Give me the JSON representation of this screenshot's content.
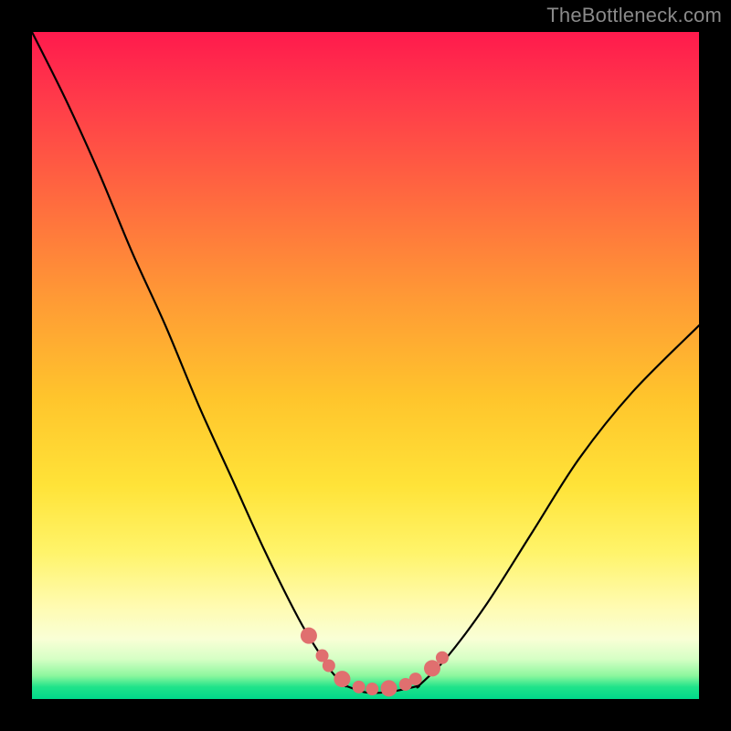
{
  "watermark": "TheBottleneck.com",
  "chart_data": {
    "type": "line",
    "title": "",
    "xlabel": "",
    "ylabel": "",
    "xlim": [
      0,
      100
    ],
    "ylim": [
      0,
      100
    ],
    "background": "red-to-green vertical gradient",
    "series": [
      {
        "name": "bottleneck-curve-left",
        "x": [
          0,
          5,
          10,
          15,
          20,
          25,
          30,
          35,
          40,
          43,
          45,
          47
        ],
        "values": [
          100,
          90,
          79,
          67,
          56,
          44,
          33,
          22,
          12,
          7,
          4,
          2
        ]
      },
      {
        "name": "bottleneck-valley",
        "x": [
          47,
          50,
          53,
          56,
          58
        ],
        "values": [
          2,
          1,
          1,
          1.5,
          2
        ]
      },
      {
        "name": "bottleneck-curve-right",
        "x": [
          58,
          62,
          68,
          75,
          82,
          90,
          100
        ],
        "values": [
          2,
          6,
          14,
          25,
          36,
          46,
          56
        ]
      }
    ],
    "marker_points": {
      "name": "highlighted-dots",
      "color": "#e06f6f",
      "x": [
        41.5,
        43.5,
        44.5,
        46.5,
        49,
        51,
        53.5,
        56,
        57.5,
        60,
        61.5
      ],
      "values": [
        9.5,
        6.5,
        5,
        3,
        1.8,
        1.5,
        1.6,
        2.2,
        3,
        4.6,
        6.2
      ]
    }
  }
}
